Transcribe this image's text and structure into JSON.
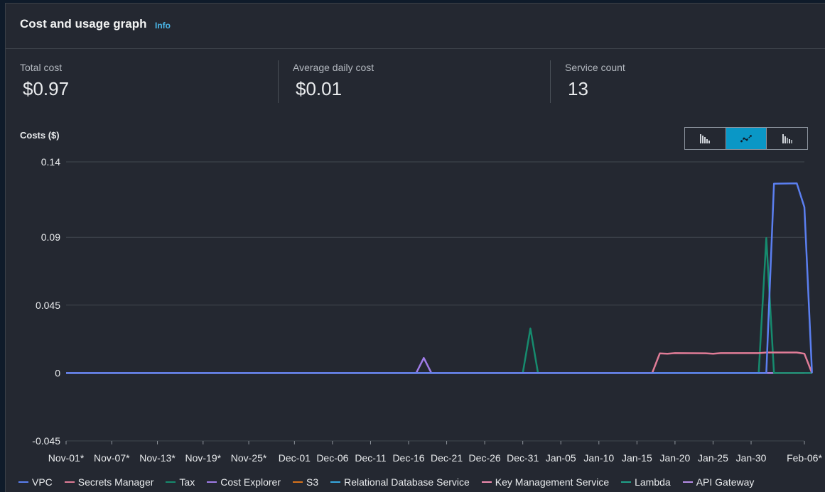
{
  "header": {
    "title": "Cost and usage graph",
    "info": "Info"
  },
  "metrics": [
    {
      "label": "Total cost",
      "value": "$0.97"
    },
    {
      "label": "Average daily cost",
      "value": "$0.01"
    },
    {
      "label": "Service count",
      "value": "13"
    }
  ],
  "toggle": {
    "options": [
      "bar-chart-icon",
      "line-chart-icon",
      "stacked-bar-chart-icon"
    ],
    "selected": "line-chart-icon"
  },
  "colors": {
    "VPC": "#5b7ff0",
    "Secrets Manager": "#e07c97",
    "Tax": "#168b6e",
    "Cost Explorer": "#a07ce8",
    "S3": "#d8731c",
    "Relational Database Service": "#37a8e0",
    "Key Management Service": "#f28cb0",
    "Lambda": "#20a188",
    "API Gateway": "#b78de8",
    "baseline": "#c1a320"
  },
  "chart_data": {
    "type": "line",
    "ylabel": "Costs ($)",
    "ylim": [
      -0.045,
      0.14
    ],
    "yticks": [
      "0.14",
      "0.09",
      "0.045",
      "0",
      "-0.045"
    ],
    "ytick_values": [
      0.14,
      0.09,
      0.045,
      0,
      -0.045
    ],
    "xticks": [
      "Nov-01*",
      "Nov-07*",
      "Nov-13*",
      "Nov-19*",
      "Nov-25*",
      "Dec-01",
      "Dec-06",
      "Dec-11",
      "Dec-16",
      "Dec-21",
      "Dec-26",
      "Dec-31",
      "Jan-05",
      "Jan-10",
      "Jan-15",
      "Jan-20",
      "Jan-25",
      "Jan-30",
      "Feb-06*"
    ],
    "x_start": "Nov-01",
    "x_end": "Feb-06",
    "grid": true,
    "legend_position": "bottom",
    "series": [
      {
        "name": "VPC",
        "points": [
          [
            "Nov-01",
            0
          ],
          [
            "Feb-01",
            0
          ],
          [
            "Feb-02",
            0.1255
          ],
          [
            "Feb-05",
            0.1258
          ],
          [
            "Feb-06",
            0.11
          ],
          [
            "Feb-07",
            0
          ]
        ]
      },
      {
        "name": "Secrets Manager",
        "points": [
          [
            "Nov-01",
            0
          ],
          [
            "Jan-17",
            0
          ],
          [
            "Jan-18",
            0.013
          ],
          [
            "Jan-19",
            0.0128
          ],
          [
            "Jan-20",
            0.0132
          ],
          [
            "Jan-24",
            0.0131
          ],
          [
            "Jan-25",
            0.0128
          ],
          [
            "Jan-26",
            0.0132
          ],
          [
            "Jan-31",
            0.0132
          ],
          [
            "Feb-01",
            0.0136
          ],
          [
            "Feb-05",
            0.0136
          ],
          [
            "Feb-06",
            0.0128
          ],
          [
            "Feb-07",
            0
          ]
        ]
      },
      {
        "name": "Tax",
        "points": [
          [
            "Nov-01",
            0
          ],
          [
            "Dec-31",
            0
          ],
          [
            "Jan-01",
            0.0295
          ],
          [
            "Jan-02",
            0
          ],
          [
            "Jan-31",
            0
          ],
          [
            "Feb-01",
            0.0895
          ],
          [
            "Feb-02",
            0
          ],
          [
            "Feb-07",
            0
          ]
        ]
      },
      {
        "name": "Cost Explorer",
        "points": [
          [
            "Nov-01",
            0
          ],
          [
            "Dec-17",
            0
          ],
          [
            "Dec-18",
            0.01
          ],
          [
            "Dec-19",
            0
          ],
          [
            "Feb-07",
            0
          ]
        ]
      },
      {
        "name": "S3",
        "points": [
          [
            "Nov-01",
            0
          ],
          [
            "Feb-07",
            0
          ]
        ]
      },
      {
        "name": "Relational Database Service",
        "points": [
          [
            "Nov-01",
            0
          ],
          [
            "Feb-07",
            0
          ]
        ]
      },
      {
        "name": "Key Management Service",
        "points": [
          [
            "Nov-01",
            0
          ],
          [
            "Feb-07",
            0
          ]
        ]
      },
      {
        "name": "Lambda",
        "points": [
          [
            "Nov-01",
            0
          ],
          [
            "Feb-07",
            0
          ]
        ]
      },
      {
        "name": "API Gateway",
        "points": [
          [
            "Nov-01",
            0
          ],
          [
            "Feb-07",
            0
          ]
        ]
      }
    ]
  }
}
